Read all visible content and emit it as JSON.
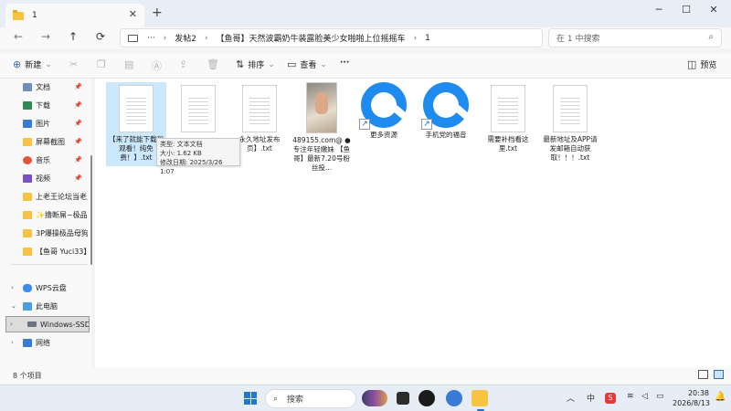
{
  "window": {
    "tab_title": "1",
    "tab_close": "✕",
    "new_tab": "+",
    "minimize": "─",
    "maximize": "☐",
    "close": "✕"
  },
  "nav": {
    "back": "←",
    "forward": "→",
    "up": "↑",
    "refresh": "⟳",
    "more": "···",
    "breadcrumb": [
      "发帖2",
      "【鱼哥】天然波霸奶牛装露脸美少女啪啪上位摇摇车",
      "1"
    ],
    "search_placeholder": "在 1 中搜索"
  },
  "toolbar": {
    "new_label": "新建",
    "sort_label": "排序",
    "view_label": "查看",
    "more_label": "···",
    "preview_label": "预览"
  },
  "sidebar": {
    "quick_access": [
      {
        "label": "文档",
        "icon": "documents-icon",
        "color": "#6f8fb8"
      },
      {
        "label": "下载",
        "icon": "download-icon",
        "color": "#2f8a4f"
      },
      {
        "label": "图片",
        "icon": "pictures-icon",
        "color": "#3a7bd5"
      },
      {
        "label": "屏幕截图",
        "icon": "folder-icon",
        "color": "#f7c341"
      },
      {
        "label": "音乐",
        "icon": "music-icon",
        "color": "#e4543b"
      },
      {
        "label": "视频",
        "icon": "video-icon",
        "color": "#7a4fc7"
      }
    ],
    "folders": [
      {
        "label": "上老王论坛当老王"
      },
      {
        "label": "✨撸断屌~极品幼"
      },
      {
        "label": "3P爆操极品母狗"
      },
      {
        "label": "【鱼哥 Yuci33】"
      }
    ],
    "wps": "WPS云盘",
    "this_pc": "此电脑",
    "drive": "Windows-SSD",
    "network": "网络"
  },
  "files": [
    {
      "name": "【来了就能下载和观看！纯免费！】.txt",
      "type": "doc",
      "selected": true
    },
    {
      "name": "",
      "type": "doc",
      "selected": false
    },
    {
      "name": "永久地址发布页】.txt",
      "type": "doc",
      "selected": false
    },
    {
      "name": "489155.com@ ●专注年轻嫩妹 【鱼哥】最新7.20号粉丝投...",
      "type": "image",
      "selected": false
    },
    {
      "name": "更多资源",
      "type": "qq-shortcut",
      "selected": false
    },
    {
      "name": "手机党的福音",
      "type": "qq-shortcut",
      "selected": false
    },
    {
      "name": "需要补档看这里.txt",
      "type": "doc",
      "selected": false
    },
    {
      "name": "最新地址及APP请发邮箱自动获取！！！.txt",
      "type": "doc",
      "selected": false
    }
  ],
  "tooltip": {
    "type_line": "类型: 文本文档",
    "size_line": "大小: 1.62 KB",
    "date_line": "修改日期: 2025/3/26 1:07"
  },
  "status": {
    "item_count": "8 个项目"
  },
  "taskbar": {
    "search_label": "搜索",
    "clock_time": "20:38",
    "clock_date": "2026/8/13",
    "tray_chevron": "︿",
    "input_method": "中",
    "wps_badge": "S",
    "wifi": "≋",
    "volume": "◁",
    "battery": "▭"
  }
}
